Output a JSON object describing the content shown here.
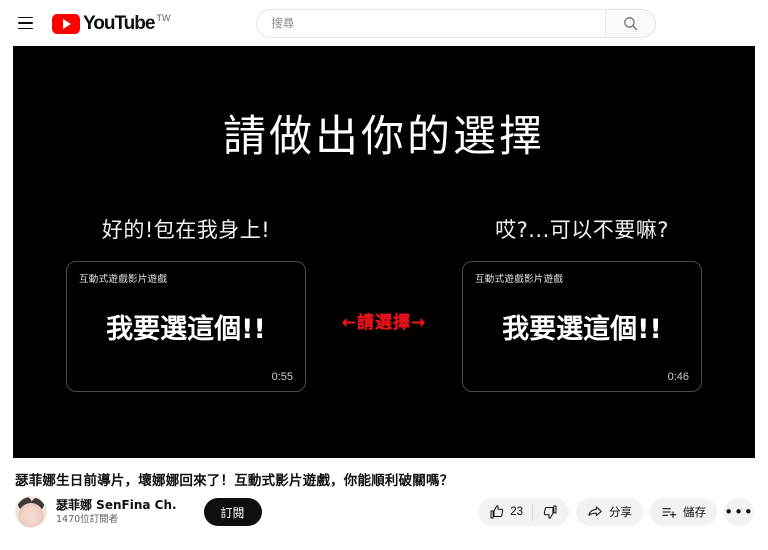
{
  "header": {
    "menu_icon": "hamburger-menu-icon",
    "logo_text": "YouTube",
    "logo_country": "TW",
    "search": {
      "placeholder": "搜尋",
      "value": "",
      "button_icon": "search-icon"
    }
  },
  "player": {
    "prompt_title": "請做出你的選擇",
    "center_prompt": "←請選擇→",
    "options": [
      {
        "label": "好的!包在我身上!",
        "card_header": "互動式遊戲影片遊戲",
        "card_text": "我要選這個!!",
        "duration": "0:55"
      },
      {
        "label": "哎?...可以不要嘛?",
        "card_header": "互動式遊戲影片遊戲",
        "card_text": "我要選這個!!",
        "duration": "0:46"
      }
    ]
  },
  "video": {
    "title": "瑟菲娜生日前導片，壞娜娜回來了！互動式影片遊戲，你能順利破關嗎？",
    "channel": {
      "name": "瑟菲娜 SenFina Ch.",
      "subscribers": "1470位訂閱者",
      "subscribe_label": "訂閱",
      "avatar_icon": "channel-avatar"
    },
    "actions": {
      "like_count": "23",
      "like_icon": "thumbs-up-icon",
      "dislike_icon": "thumbs-down-icon",
      "share_label": "分享",
      "share_icon": "share-arrow-icon",
      "save_label": "儲存",
      "save_icon": "save-playlist-icon",
      "more_label": "•••"
    }
  },
  "colors": {
    "brand_red": "#ff0000",
    "prompt_red": "#e8121b",
    "player_bg": "#000000",
    "pill_bg": "#f2f2f2",
    "dark_button": "#0f0f0f"
  }
}
